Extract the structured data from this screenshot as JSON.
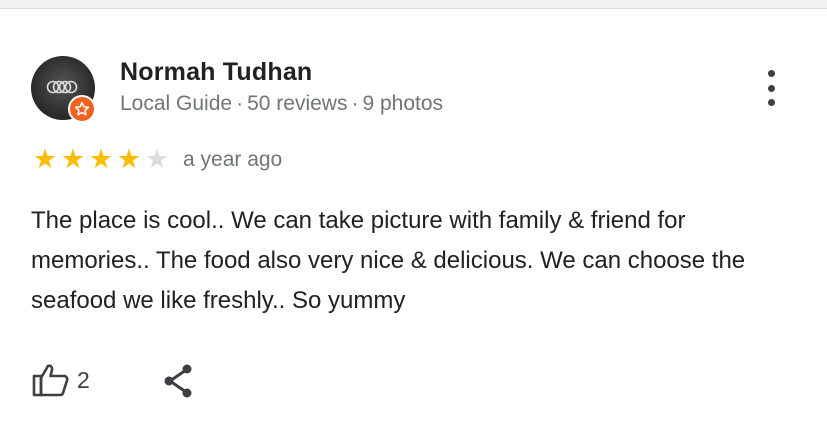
{
  "review": {
    "reviewer": {
      "name": "Normah Tudhan",
      "badge": "Local Guide",
      "reviews": "50 reviews",
      "photos": "9 photos",
      "separator": "·"
    },
    "rating": {
      "stars": 4,
      "max": 5,
      "star_color": "#fbbc04",
      "empty_color": "#dadce0"
    },
    "age": "a year ago",
    "text": "The place is cool.. We can take picture with family & friend for memories.. The food also very nice & delicious. We can choose the seafood we like freshly.. So yummy",
    "actions": {
      "like_count": "2",
      "like_icon": "thumbs-up-icon",
      "share_icon": "share-icon",
      "more_icon": "more-vert-icon"
    }
  },
  "colors": {
    "accent_badge": "#f0631f",
    "text_primary": "#202124",
    "text_secondary": "#70757a"
  }
}
